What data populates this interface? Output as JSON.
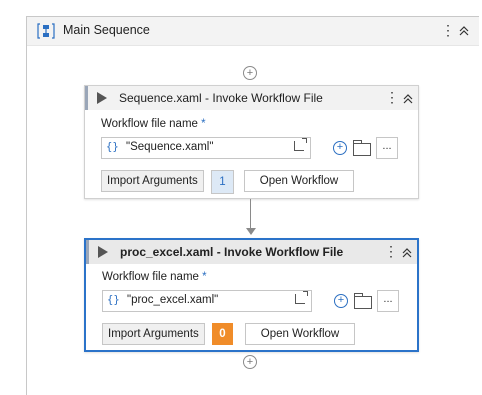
{
  "main_sequence": {
    "title": "Main Sequence",
    "more_glyph": "⋮",
    "collapse_glyph": "⌃"
  },
  "activities": [
    {
      "title": "Sequence.xaml - Invoke Workflow File",
      "field_label": "Workflow file name",
      "required_mark": "*",
      "brace": "{}",
      "file_value": "\"Sequence.xaml\"",
      "more_glyph": "⋮",
      "collapse_glyph": "⌃",
      "dots_label": "...",
      "import_label": "Import Arguments",
      "import_count": "1",
      "open_label": "Open Workflow"
    },
    {
      "title": "proc_excel.xaml - Invoke Workflow File",
      "field_label": "Workflow file name",
      "required_mark": "*",
      "brace": "{}",
      "file_value": "\"proc_excel.xaml\"",
      "more_glyph": "⋮",
      "collapse_glyph": "⌃",
      "dots_label": "...",
      "import_label": "Import Arguments",
      "import_count": "0",
      "open_label": "Open Workflow"
    }
  ],
  "icons": {
    "add": "⊕",
    "plus": "+"
  },
  "colors": {
    "selected_border": "#2b73c9",
    "warning_badge": "#f08c29",
    "info_badge": "#dde9f6"
  }
}
